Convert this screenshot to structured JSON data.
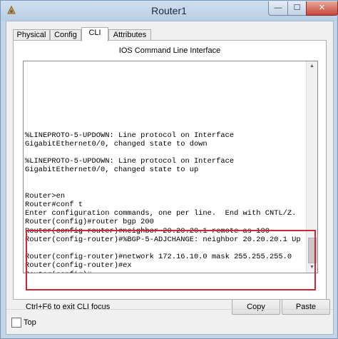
{
  "window": {
    "title": "Router1",
    "minimize_glyph": "—",
    "maximize_glyph": "☐",
    "close_glyph": "✕"
  },
  "tabs": [
    {
      "label": "Physical",
      "active": false
    },
    {
      "label": "Config",
      "active": false
    },
    {
      "label": "CLI",
      "active": true
    },
    {
      "label": "Attributes",
      "active": false
    }
  ],
  "cli": {
    "header": "IOS Command Line Interface",
    "lines": [
      "",
      "",
      "",
      "",
      "",
      "",
      "",
      "",
      "%LINEPROTO-5-UPDOWN: Line protocol on Interface",
      "GigabitEthernet0/0, changed state to down",
      "",
      "%LINEPROTO-5-UPDOWN: Line protocol on Interface",
      "GigabitEthernet0/0, changed state to up",
      "",
      "",
      "Router>en",
      "Router#conf t",
      "Enter configuration commands, one per line.  End with CNTL/Z.",
      "Router(config)#router bgp 200",
      "Router(config-router)#neighbor 20.20.20.1 remote-as 100",
      "Router(config-router)#%BGP-5-ADJCHANGE: neighbor 20.20.20.1 Up",
      "",
      "Router(config-router)#network 172.16.10.0 mask 255.255.255.0",
      "Router(config-router)#ex",
      "Router(config)#"
    ],
    "scroll_up_glyph": "▲",
    "scroll_down_glyph": "▼",
    "hint": "Ctrl+F6 to exit CLI focus",
    "copy_label": "Copy",
    "paste_label": "Paste"
  },
  "footer": {
    "top_label": "Top",
    "top_checked": false
  },
  "colors": {
    "highlight": "#d0263a",
    "window_frame": "#c4d5e8"
  },
  "icons": {
    "app": "packet-tracer-router-icon"
  }
}
